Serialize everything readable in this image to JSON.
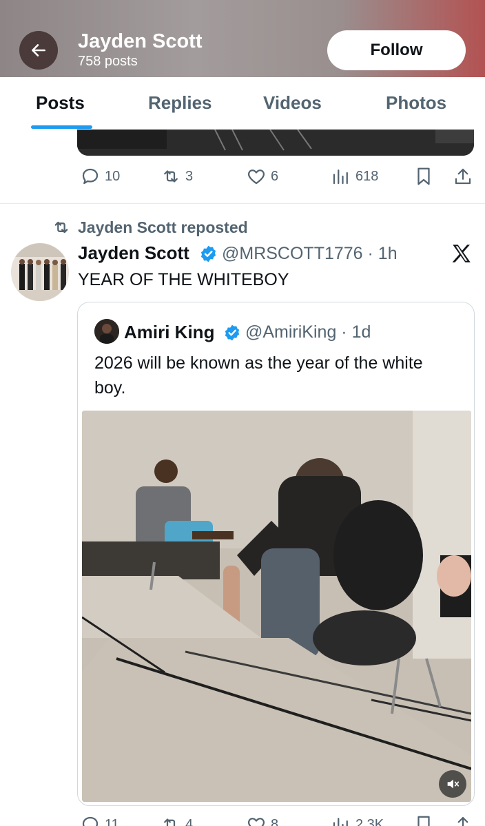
{
  "profile_header": {
    "name": "Jayden Scott",
    "posts_count": "758 posts",
    "follow_label": "Follow"
  },
  "tabs": [
    {
      "label": "Posts",
      "active": true
    },
    {
      "label": "Replies",
      "active": false
    },
    {
      "label": "Videos",
      "active": false
    },
    {
      "label": "Photos",
      "active": false
    }
  ],
  "previous_post": {
    "replies": "10",
    "reposts": "3",
    "likes": "6",
    "views": "618"
  },
  "tweet": {
    "repost_label": "Jayden Scott reposted",
    "author_name": "Jayden Scott",
    "author_handle": "@MRSCOTT1776 · 1h",
    "text": "YEAR OF THE WHITEBOY",
    "quoted": {
      "author_name": "Amiri King",
      "author_handle": "@AmiriKing · 1d",
      "text": "2026 will be known as the year of the white boy."
    },
    "stats": {
      "replies": "11",
      "reposts": "4",
      "likes": "8",
      "views": "2.3K"
    }
  },
  "colors": {
    "accent": "#1d9bf0",
    "secondary_text": "#536471",
    "primary_text": "#0f1419"
  },
  "icons": [
    "back-arrow-icon",
    "reply-icon",
    "repost-icon",
    "like-icon",
    "views-icon",
    "bookmark-icon",
    "share-icon",
    "verified-badge-icon",
    "x-logo-icon",
    "mute-icon"
  ]
}
